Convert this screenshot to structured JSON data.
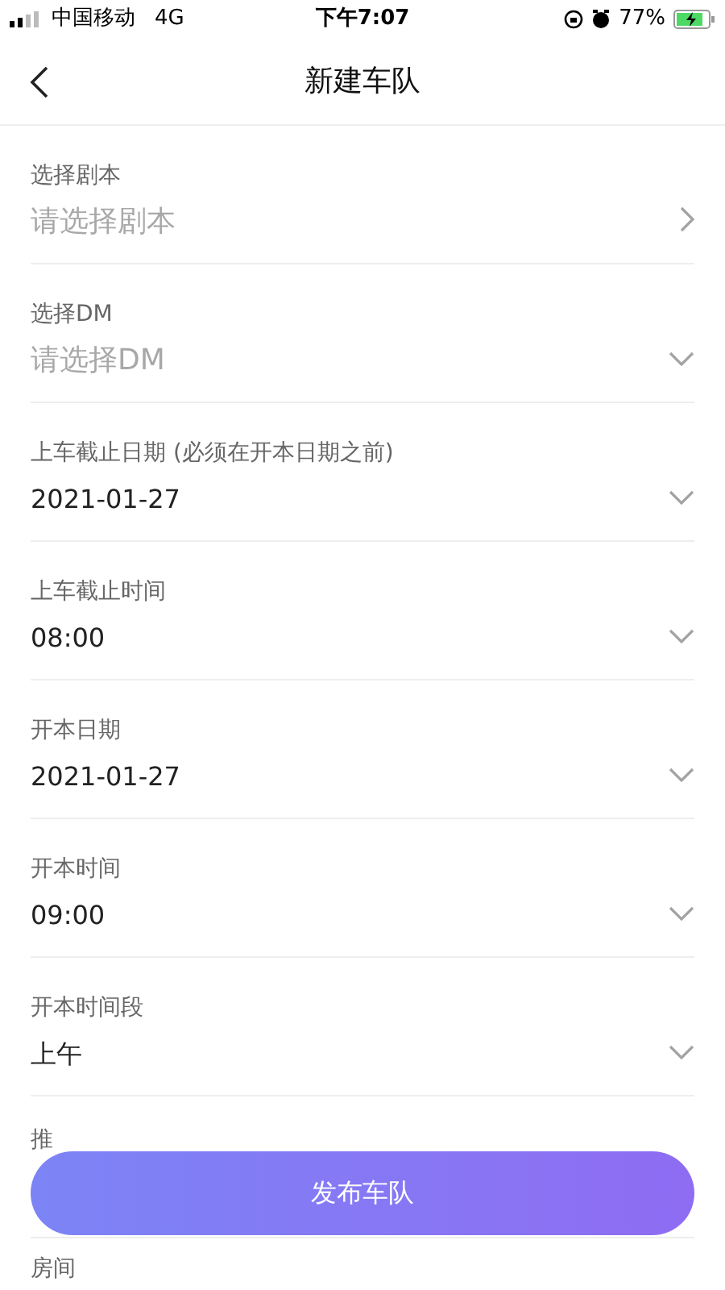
{
  "status_bar": {
    "carrier": "中国移动",
    "network": "4G",
    "time": "下午7:07",
    "battery": "77%"
  },
  "nav": {
    "title": "新建车队"
  },
  "fields": [
    {
      "label": "选择剧本",
      "placeholder": "请选择剧本",
      "kind": "link"
    },
    {
      "label": "选择DM",
      "placeholder": "请选择DM",
      "kind": "select"
    },
    {
      "label": "上车截止日期 (必须在开本日期之前)",
      "value": "2021-01-27",
      "kind": "select"
    },
    {
      "label": "上车截止时间",
      "value": "08:00",
      "kind": "select"
    },
    {
      "label": "开本日期",
      "value": "2021-01-27",
      "kind": "select"
    },
    {
      "label": "开本时间",
      "value": "09:00",
      "kind": "select"
    },
    {
      "label": "开本时间段",
      "value": "上午",
      "kind": "select"
    },
    {
      "label": "推",
      "kind": "partial"
    },
    {
      "label": "房间",
      "kind": "partial"
    }
  ],
  "submit": {
    "label": "发布车队"
  }
}
